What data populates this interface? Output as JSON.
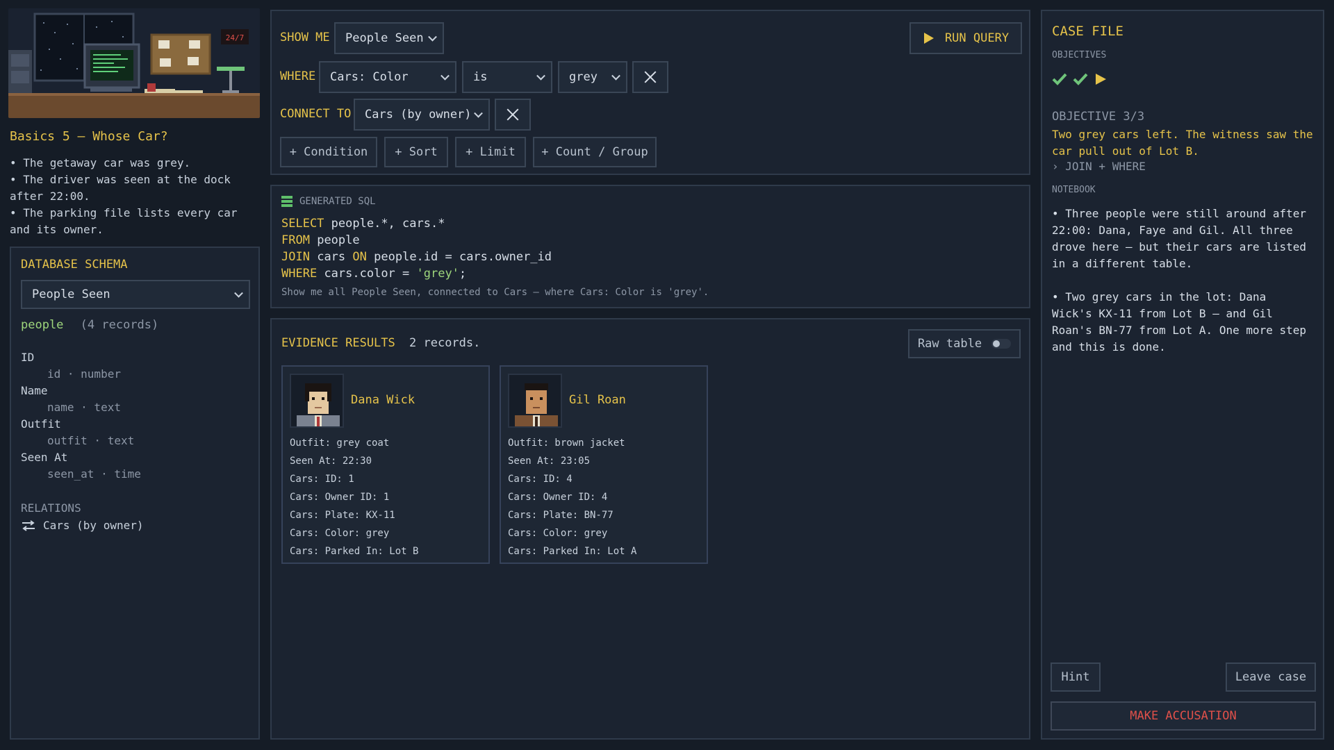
{
  "scene": {
    "clock": "24/7"
  },
  "case": {
    "title": "Basics 5 — Whose Car?",
    "clues": [
      "• The getaway car was grey.",
      "• The driver was seen at the dock after 22:00.",
      "• The parking file lists every car and its owner."
    ]
  },
  "schema": {
    "heading": "DATABASE SCHEMA",
    "selected_table": "People Seen",
    "table_name": "people",
    "record_count": "(4 records)",
    "fields": [
      {
        "label": "ID",
        "column": "id · number"
      },
      {
        "label": "Name",
        "column": "name · text"
      },
      {
        "label": "Outfit",
        "column": "outfit · text"
      },
      {
        "label": "Seen At",
        "column": "seen_at · time"
      }
    ],
    "relations_heading": "RELATIONS",
    "relations": [
      {
        "icon": "swap-arrows-icon",
        "label": "Cars (by owner)"
      }
    ]
  },
  "query": {
    "show_me_label": "SHOW ME",
    "show_me_value": "People Seen",
    "run_label": "RUN QUERY",
    "where_label": "WHERE",
    "where_field": "Cars: Color",
    "where_operator": "is",
    "where_value": "grey",
    "connect_label": "CONNECT TO",
    "connect_value": "Cars (by owner)",
    "add_buttons": [
      "+ Condition",
      "+ Sort",
      "+ Limit",
      "+ Count / Group"
    ]
  },
  "sql": {
    "heading": "GENERATED SQL",
    "lines": [
      {
        "kw": "SELECT",
        "rest": "people.*, cars.*"
      },
      {
        "kw": "FROM",
        "rest": "people"
      },
      {
        "kw": "JOIN",
        "rest": "cars",
        "kw2": "ON",
        "rest2": "people.id = cars.owner_id"
      },
      {
        "kw": "WHERE",
        "rest": "cars.color = ",
        "str": "'grey'",
        "tail": ";"
      }
    ],
    "plain": "Show me all People Seen, connected to Cars — where Cars: Color is 'grey'."
  },
  "results": {
    "heading": "EVIDENCE RESULTS",
    "count": "2 records.",
    "raw_toggle_label": "Raw table",
    "raw_toggle_on": false,
    "cards": [
      {
        "name": "Dana Wick",
        "rows": [
          "Outfit: grey coat",
          "Seen At: 22:30",
          "Cars: ID: 1",
          "Cars: Owner ID: 1",
          "Cars: Plate: KX-11",
          "Cars: Color: grey",
          "Cars: Parked In: Lot B"
        ]
      },
      {
        "name": "Gil Roan",
        "rows": [
          "Outfit: brown jacket",
          "Seen At: 23:05",
          "Cars: ID: 4",
          "Cars: Owner ID: 4",
          "Cars: Plate: BN-77",
          "Cars: Color: grey",
          "Cars: Parked In: Lot A"
        ]
      }
    ]
  },
  "casefile": {
    "heading": "CASE FILE",
    "objectives_label": "OBJECTIVES",
    "objectives_status": [
      "check",
      "check",
      "current"
    ],
    "objective_counter": "OBJECTIVE 3/3",
    "objective_text": "Two grey cars left. The witness saw the car pull out of Lot B.",
    "objective_hint": "› JOIN + WHERE",
    "notebook_label": "NOTEBOOK",
    "notes": [
      "• Three people were still around after 22:00: Dana, Faye and Gil. All three drove here — but their cars are listed in a different table.",
      "• Two grey cars in the lot: Dana Wick's KX-11 from Lot B — and Gil Roan's BN-77 from Lot A. One more step and this is done."
    ],
    "hint_label": "Hint",
    "leave_label": "Leave case",
    "accuse_label": "MAKE ACCUSATION"
  },
  "colors": {
    "accent_yellow": "#e6c34a",
    "accent_green": "#9ed67c",
    "accuse_red": "#e0504a"
  }
}
